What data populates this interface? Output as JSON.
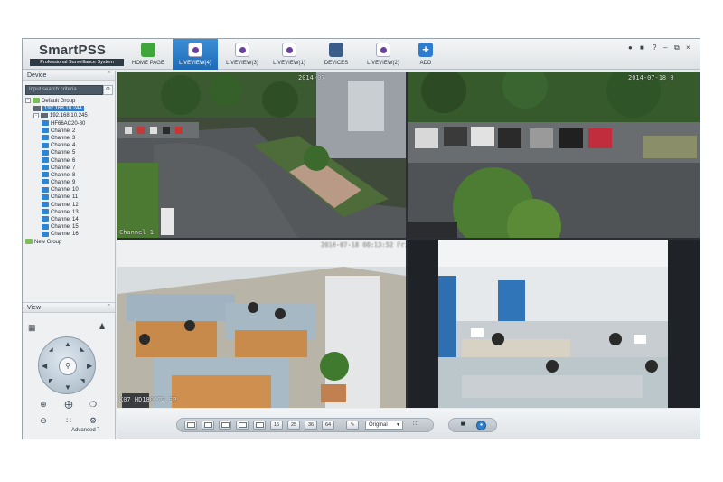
{
  "app": {
    "brand_title": "SmartPSS",
    "brand_subtitle": "Professional Surveillance System",
    "tabs": [
      {
        "label": "HOME PAGE",
        "icon": "home-icon"
      },
      {
        "label": "LIVEVIEW(4)",
        "icon": "liveview-icon",
        "active": true
      },
      {
        "label": "LIVEVIEW(3)",
        "icon": "liveview-icon"
      },
      {
        "label": "LIVEVIEW(1)",
        "icon": "liveview-icon"
      },
      {
        "label": "DEVICES",
        "icon": "devices-icon"
      },
      {
        "label": "LIVEVIEW(2)",
        "icon": "liveview-icon"
      },
      {
        "label": "ADD",
        "icon": "add-icon"
      }
    ],
    "window_controls": [
      "user-icon",
      "lock-icon",
      "help-icon",
      "minimize-icon",
      "restore-icon",
      "close-icon"
    ]
  },
  "sidebar": {
    "device_header": "Device",
    "search_placeholder": "Input search criteria",
    "tree": [
      {
        "label": "Default Group",
        "level": 0,
        "type": "folder",
        "toggle": "-"
      },
      {
        "label": "192.168.10.244",
        "level": 1,
        "type": "device",
        "selected": true
      },
      {
        "label": "192.168.10.245",
        "level": 1,
        "type": "device",
        "toggle": "-"
      },
      {
        "label": "HF66AC20-80",
        "level": 2,
        "type": "camera"
      },
      {
        "label": "Channel 2",
        "level": 2,
        "type": "camera"
      },
      {
        "label": "Channel 3",
        "level": 2,
        "type": "camera"
      },
      {
        "label": "Channel 4",
        "level": 2,
        "type": "camera"
      },
      {
        "label": "Channel 5",
        "level": 2,
        "type": "camera"
      },
      {
        "label": "Channel 6",
        "level": 2,
        "type": "camera"
      },
      {
        "label": "Channel 7",
        "level": 2,
        "type": "camera"
      },
      {
        "label": "Channel 8",
        "level": 2,
        "type": "camera"
      },
      {
        "label": "Channel 9",
        "level": 2,
        "type": "camera"
      },
      {
        "label": "Channel 10",
        "level": 2,
        "type": "camera"
      },
      {
        "label": "Channel 11",
        "level": 2,
        "type": "camera"
      },
      {
        "label": "Channel 12",
        "level": 2,
        "type": "camera"
      },
      {
        "label": "Channel 13",
        "level": 2,
        "type": "camera"
      },
      {
        "label": "Channel 14",
        "level": 2,
        "type": "camera"
      },
      {
        "label": "Channel 15",
        "level": 2,
        "type": "camera"
      },
      {
        "label": "Channel 16",
        "level": 2,
        "type": "camera"
      },
      {
        "label": "New Group",
        "level": 0,
        "type": "folder"
      }
    ],
    "view_header": "View",
    "advanced_label": "Advanced"
  },
  "video": {
    "cells": [
      {
        "timestamp": "2014-07",
        "channel": "Channel 1"
      },
      {
        "timestamp": "2014-07-18 0"
      },
      {
        "timestamp": "2014-07-18 08:13:52 Fri",
        "channel": "K07 HD180C72 EP"
      },
      {
        "timestamp": ""
      }
    ]
  },
  "toolbar": {
    "layout_buttons": [
      "1",
      "4",
      "6",
      "8",
      "9",
      "16",
      "25",
      "36",
      "64"
    ],
    "stream_select": "Original",
    "icons": [
      "fullscreen-icon",
      "save-icon",
      "record-icon"
    ]
  }
}
